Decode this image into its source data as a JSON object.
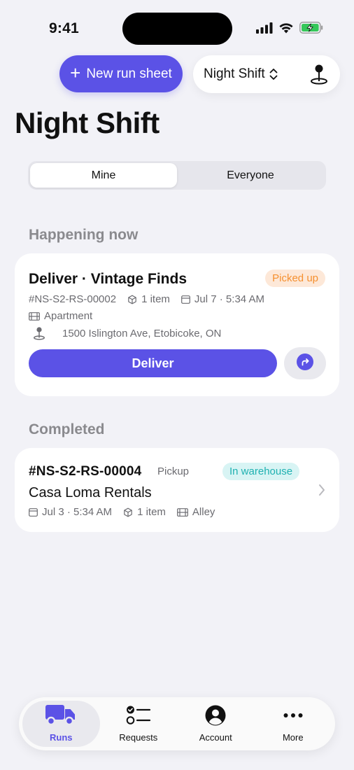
{
  "status_bar": {
    "time": "9:41"
  },
  "header": {
    "new_run_sheet_label": "New run sheet",
    "shift_picker_label": "Night Shift"
  },
  "page_title": "Night Shift",
  "segmented": {
    "mine": "Mine",
    "everyone": "Everyone",
    "selected": "Mine"
  },
  "happening_now": {
    "section_title": "Happening now",
    "card": {
      "title": "Deliver · Vintage Finds",
      "status": "Picked up",
      "id": "#NS-S2-RS-00002",
      "items": "1 item",
      "date": "Jul 7 · 5:34 AM",
      "location_type": "Apartment",
      "address": "1500 Islington Ave, Etobicoke, ON",
      "action_label": "Deliver"
    }
  },
  "completed": {
    "section_title": "Completed",
    "card": {
      "id": "#NS-S2-RS-00004",
      "type": "Pickup",
      "status": "In warehouse",
      "name": "Casa Loma Rentals",
      "date": "Jul 3 · 5:34 AM",
      "items": "1 item",
      "location_type": "Alley"
    }
  },
  "tab_bar": {
    "tabs": [
      {
        "label": "Runs",
        "icon": "truck-icon",
        "active": true
      },
      {
        "label": "Requests",
        "icon": "checklist-icon",
        "active": false
      },
      {
        "label": "Account",
        "icon": "person-circle-icon",
        "active": false
      },
      {
        "label": "More",
        "icon": "ellipsis-icon",
        "active": false
      }
    ]
  },
  "colors": {
    "accent": "#5b52e6",
    "background": "#f2f2f7",
    "picked_up_text": "#f5902f",
    "picked_up_bg": "#fde8d8",
    "warehouse_text": "#1fb1b1",
    "warehouse_bg": "#d8f4f4"
  }
}
